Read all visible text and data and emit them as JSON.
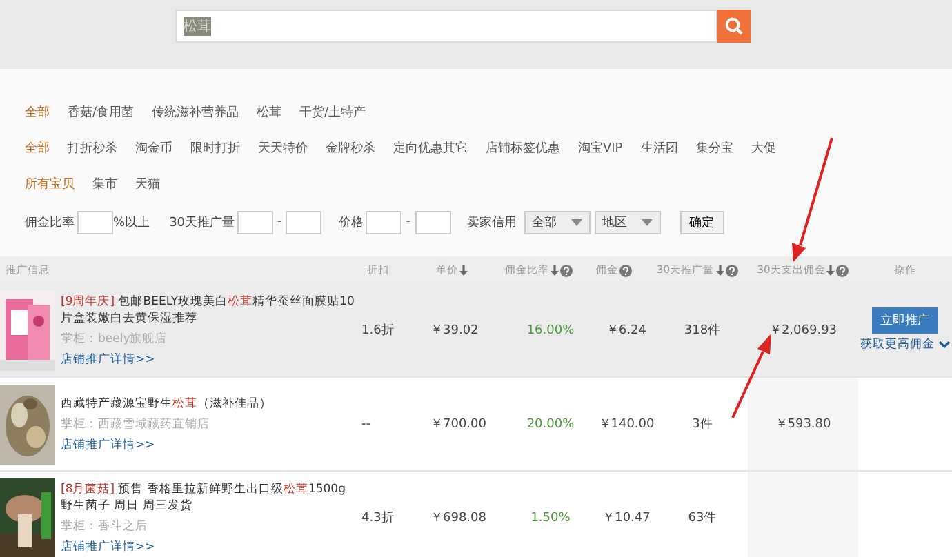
{
  "search": {
    "value": "松茸"
  },
  "filters": [
    {
      "items": [
        {
          "label": "全部",
          "selected": true
        },
        {
          "label": "香菇/食用菌",
          "selected": false
        },
        {
          "label": "传统滋补营养品",
          "selected": false
        },
        {
          "label": "松茸",
          "selected": false
        },
        {
          "label": "干货/土特产",
          "selected": false
        }
      ]
    },
    {
      "items": [
        {
          "label": "全部",
          "selected": true
        },
        {
          "label": "打折秒杀",
          "selected": false
        },
        {
          "label": "淘金币",
          "selected": false
        },
        {
          "label": "限时打折",
          "selected": false
        },
        {
          "label": "天天特价",
          "selected": false
        },
        {
          "label": "金牌秒杀",
          "selected": false
        },
        {
          "label": "定向优惠其它",
          "selected": false
        },
        {
          "label": "店铺标签优惠",
          "selected": false
        },
        {
          "label": "淘宝VIP",
          "selected": false
        },
        {
          "label": "生活团",
          "selected": false
        },
        {
          "label": "集分宝",
          "selected": false
        },
        {
          "label": "大促",
          "selected": false
        }
      ]
    },
    {
      "items": [
        {
          "label": "所有宝贝",
          "selected": true
        },
        {
          "label": "集市",
          "selected": false
        },
        {
          "label": "天猫",
          "selected": false
        }
      ]
    }
  ],
  "criteria": {
    "rate_label": "佣金比率",
    "rate_suffix": "%以上",
    "volume_label": "30天推广量",
    "dash": "-",
    "price_label": "价格",
    "credit_label": "卖家信用",
    "credit_select": "全部",
    "region_select": "地区",
    "confirm": "确定"
  },
  "table": {
    "columns": [
      {
        "label": "推广信息",
        "sort": false,
        "help": false
      },
      {
        "label": "折扣",
        "sort": false,
        "help": false
      },
      {
        "label": "单价",
        "sort": true,
        "help": false
      },
      {
        "label": "佣金比率",
        "sort": true,
        "help": true
      },
      {
        "label": "佣金",
        "sort": false,
        "help": true
      },
      {
        "label": "30天推广量",
        "sort": true,
        "help": true
      },
      {
        "label": "30天支出佣金",
        "sort": true,
        "help": true
      },
      {
        "label": "操作",
        "sort": false,
        "help": false
      }
    ],
    "rows": [
      {
        "highlighted": true,
        "title": [
          {
            "kind": "tag",
            "text": "[9周年庆]"
          },
          {
            "kind": "plain",
            "text": " 包邮BEELY玫瑰美白"
          },
          {
            "kind": "keyword",
            "text": "松茸"
          },
          {
            "kind": "plain",
            "text": "精华蚕丝面膜贴10片盒装嫩白去黄保湿推荐"
          }
        ],
        "shop": "掌柜：beely旗舰店",
        "link": "店铺推广详情>>",
        "discount": "1.6折",
        "price": "￥39.02",
        "rate": "16.00%",
        "commission": "￥6.24",
        "volume": "318件",
        "spend": "￥2,069.93",
        "action": "立即推广",
        "more": "获取更高佣金"
      },
      {
        "highlighted": false,
        "title": [
          {
            "kind": "plain",
            "text": "西藏特产藏源宝野生"
          },
          {
            "kind": "keyword",
            "text": "松茸"
          },
          {
            "kind": "plain",
            "text": "（滋补佳品）"
          }
        ],
        "shop": "掌柜：西藏雪域藏药直销店",
        "link": "店铺推广详情>>",
        "discount": "--",
        "price": "￥700.00",
        "rate": "20.00%",
        "commission": "￥140.00",
        "volume": "3件",
        "spend": "￥593.80"
      },
      {
        "highlighted": false,
        "title": [
          {
            "kind": "tag",
            "text": "[8月菌菇]"
          },
          {
            "kind": "plain",
            "text": " 预售 香格里拉新鲜野生出口级"
          },
          {
            "kind": "keyword",
            "text": "松茸"
          },
          {
            "kind": "plain",
            "text": "1500g 野生菌子 周日 周三发货"
          }
        ],
        "shop": "掌柜：香斗之后",
        "link": "店铺推广详情>>",
        "discount": "4.3折",
        "price": "￥698.08",
        "rate": "1.50%",
        "commission": "￥10.47",
        "volume": "63件"
      }
    ]
  }
}
